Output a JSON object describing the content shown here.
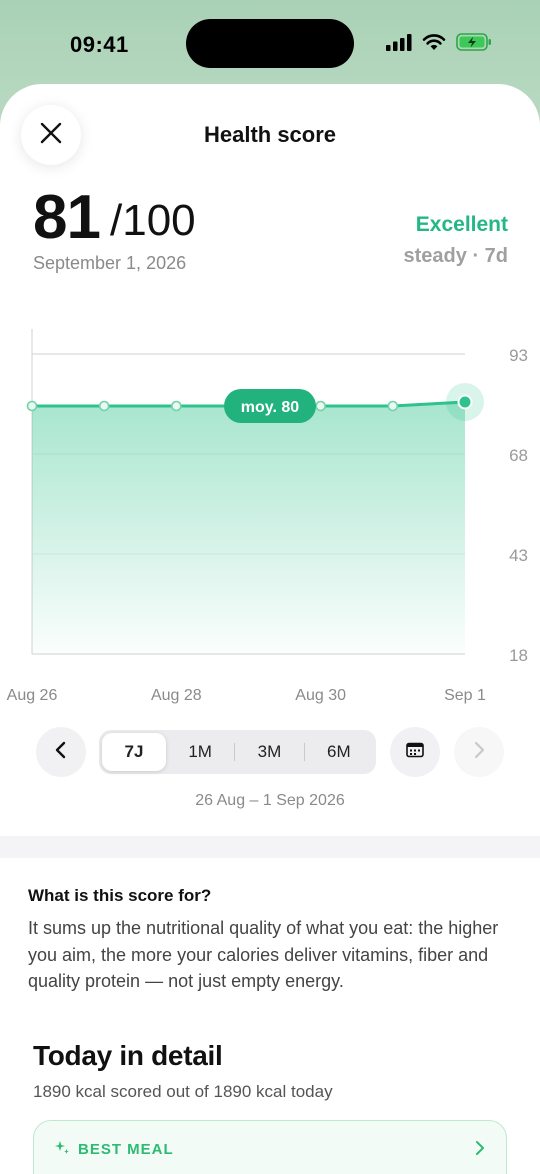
{
  "status_bar": {
    "time": "09:41"
  },
  "header": {
    "title": "Health score",
    "close_icon": "close-icon"
  },
  "score": {
    "value": "81",
    "max": "/100",
    "date": "September 1, 2026",
    "rating": "Excellent",
    "trend": "steady · 7d",
    "accent_color": "#23b883"
  },
  "chart_data": {
    "type": "area",
    "x": [
      "Aug 26",
      "Aug 27",
      "Aug 28",
      "Aug 29",
      "Aug 30",
      "Aug 31",
      "Sep 1"
    ],
    "x_tick_labels": [
      "Aug 26",
      "Aug 28",
      "Aug 30",
      "Sep 1"
    ],
    "y_tick_labels": [
      "93",
      "68",
      "43",
      "18"
    ],
    "values": [
      80,
      80,
      80,
      80,
      80,
      80,
      81
    ],
    "ylim": [
      18,
      93
    ],
    "average_label": "moy. 80",
    "average": 80,
    "grid": true,
    "color": "#2ec28c"
  },
  "period": {
    "options": [
      "7J",
      "1M",
      "3M",
      "6M"
    ],
    "selected": "7J",
    "range": "26 Aug – 1 Sep 2026"
  },
  "info": {
    "title": "What is this score for?",
    "text": "It sums up the nutritional quality of what you eat: the higher you aim, the more your calories deliver vitamins, fiber and quality protein — not just empty energy."
  },
  "today": {
    "title": "Today in detail",
    "subtitle": "1890 kcal scored out of 1890 kcal today",
    "best_meal_label": "BEST MEAL"
  }
}
